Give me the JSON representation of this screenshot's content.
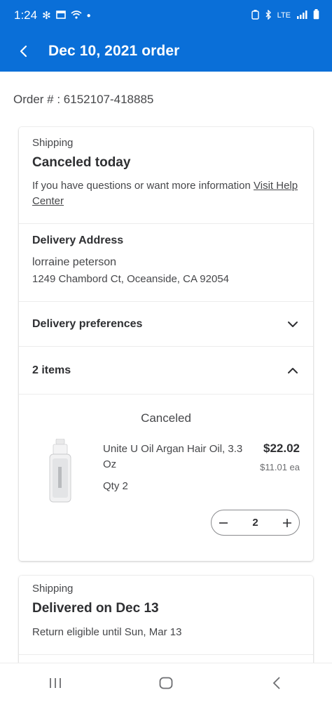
{
  "status_bar": {
    "time": "1:24",
    "network": "LTE"
  },
  "header": {
    "title": "Dec 10, 2021 order"
  },
  "order": {
    "number_text": "Order # : 6152107-418885"
  },
  "shipment1": {
    "label": "Shipping",
    "status": "Canceled today",
    "help_text": "If you have questions or want more information ",
    "help_link": "Visit Help Center"
  },
  "address": {
    "heading": "Delivery Address",
    "name": "lorraine peterson",
    "line": "1249 Chambord Ct, Oceanside, CA 92054"
  },
  "preferences": {
    "label": "Delivery preferences"
  },
  "items_section": {
    "label": "2 items",
    "item_status": "Canceled",
    "item": {
      "name": "Unite U Oil Argan Hair Oil, 3.3 Oz",
      "qty": "Qty 2",
      "price": "$22.02",
      "each": "$11.01 ea",
      "stepper_value": "2"
    }
  },
  "shipment2": {
    "label": "Shipping",
    "status": "Delivered on Dec 13",
    "return_text": "Return eligible until Sun, Mar 13"
  },
  "colors": {
    "brand_blue": "#0a6fd8"
  }
}
